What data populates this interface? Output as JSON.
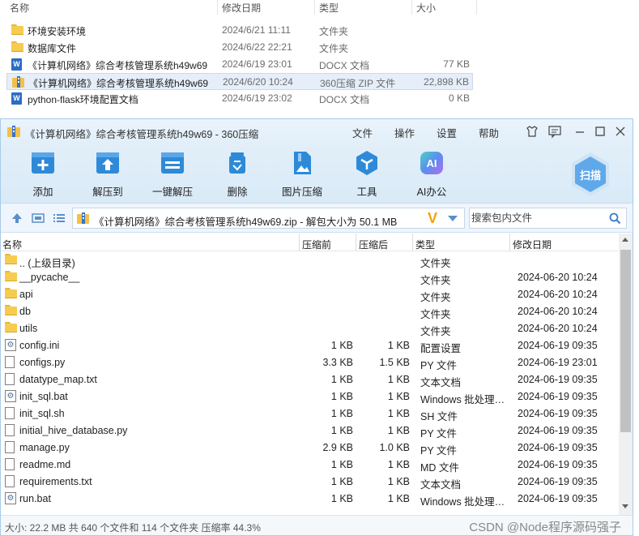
{
  "explorer": {
    "columns": [
      "名称",
      "修改日期",
      "类型",
      "大小"
    ],
    "rows": [
      {
        "icon": "folder-icon",
        "name": "环境安装环境",
        "date": "2024/6/21 11:11",
        "type": "文件夹",
        "size": ""
      },
      {
        "icon": "folder-icon",
        "name": "数据库文件",
        "date": "2024/6/22 22:21",
        "type": "文件夹",
        "size": ""
      },
      {
        "icon": "docx-icon",
        "name": "《计算机网络》综合考核管理系统h49w69",
        "date": "2024/6/19 23:01",
        "type": "DOCX 文档",
        "size": "77 KB"
      },
      {
        "icon": "zip-icon",
        "name": "《计算机网络》综合考核管理系统h49w69",
        "date": "2024/6/20 10:24",
        "type": "360压缩 ZIP 文件",
        "size": "22,898 KB"
      },
      {
        "icon": "docx-icon",
        "name": "python-flask环境配置文档",
        "date": "2024/6/19 23:02",
        "type": "DOCX 文档",
        "size": "0 KB"
      }
    ]
  },
  "window": {
    "title": "《计算机网络》综合考核管理系统h49w69 - 360压缩",
    "menu": [
      "文件",
      "操作",
      "设置",
      "帮助"
    ],
    "toolbar": [
      {
        "label": "添加",
        "icon": "add-icon"
      },
      {
        "label": "解压到",
        "icon": "extract-to-icon"
      },
      {
        "label": "一键解压",
        "icon": "one-click-extract-icon"
      },
      {
        "label": "删除",
        "icon": "delete-icon"
      },
      {
        "label": "图片压缩",
        "icon": "image-compress-icon"
      },
      {
        "label": "工具",
        "icon": "tools-icon"
      },
      {
        "label": "AI办公",
        "icon": "ai-office-icon"
      }
    ],
    "scan_label": "扫描",
    "ai_badge": "AI",
    "address": "《计算机网络》综合考核管理系统h49w69.zip - 解包大小为 50.1 MB",
    "address_logo": "V",
    "search_placeholder": "搜索包内文件",
    "columns": [
      "名称",
      "压缩前",
      "压缩后",
      "类型",
      "修改日期"
    ],
    "files": [
      {
        "icon": "folder-icon",
        "name": ".. (上级目录)",
        "csize": "",
        "size": "",
        "type": "文件夹",
        "date": ""
      },
      {
        "icon": "folder-icon",
        "name": "__pycache__",
        "csize": "",
        "size": "",
        "type": "文件夹",
        "date": "2024-06-20 10:24"
      },
      {
        "icon": "folder-icon",
        "name": "api",
        "csize": "",
        "size": "",
        "type": "文件夹",
        "date": "2024-06-20 10:24"
      },
      {
        "icon": "folder-icon",
        "name": "db",
        "csize": "",
        "size": "",
        "type": "文件夹",
        "date": "2024-06-20 10:24"
      },
      {
        "icon": "folder-icon",
        "name": "utils",
        "csize": "",
        "size": "",
        "type": "文件夹",
        "date": "2024-06-20 10:24"
      },
      {
        "icon": "settings-file-icon",
        "name": "config.ini",
        "csize": "1 KB",
        "size": "1 KB",
        "type": "配置设置",
        "date": "2024-06-19 09:35"
      },
      {
        "icon": "file-icon",
        "name": "configs.py",
        "csize": "3.3 KB",
        "size": "1.5 KB",
        "type": "PY 文件",
        "date": "2024-06-19 23:01"
      },
      {
        "icon": "file-icon",
        "name": "datatype_map.txt",
        "csize": "1 KB",
        "size": "1 KB",
        "type": "文本文档",
        "date": "2024-06-19 09:35"
      },
      {
        "icon": "settings-file-icon",
        "name": "init_sql.bat",
        "csize": "1 KB",
        "size": "1 KB",
        "type": "Windows 批处理…",
        "date": "2024-06-19 09:35"
      },
      {
        "icon": "file-icon",
        "name": "init_sql.sh",
        "csize": "1 KB",
        "size": "1 KB",
        "type": "SH 文件",
        "date": "2024-06-19 09:35"
      },
      {
        "icon": "file-icon",
        "name": "initial_hive_database.py",
        "csize": "1 KB",
        "size": "1 KB",
        "type": "PY 文件",
        "date": "2024-06-19 09:35"
      },
      {
        "icon": "file-icon",
        "name": "manage.py",
        "csize": "2.9 KB",
        "size": "1.0 KB",
        "type": "PY 文件",
        "date": "2024-06-19 09:35"
      },
      {
        "icon": "file-icon",
        "name": "readme.md",
        "csize": "1 KB",
        "size": "1 KB",
        "type": "MD 文件",
        "date": "2024-06-19 09:35"
      },
      {
        "icon": "file-icon",
        "name": "requirements.txt",
        "csize": "1 KB",
        "size": "1 KB",
        "type": "文本文档",
        "date": "2024-06-19 09:35"
      },
      {
        "icon": "settings-file-icon",
        "name": "run.bat",
        "csize": "1 KB",
        "size": "1 KB",
        "type": "Windows 批处理…",
        "date": "2024-06-19 09:35"
      }
    ],
    "status": "大小: 22.2 MB 共 640 个文件和 114 个文件夹 压缩率 44.3%",
    "watermark": "CSDN @Node程序源码强子"
  },
  "colors": {
    "accent": "#2e8ad8",
    "folder": "#f6cc4f",
    "titlebar": "#e6f1fb",
    "selected_row": "#e5eef9"
  }
}
